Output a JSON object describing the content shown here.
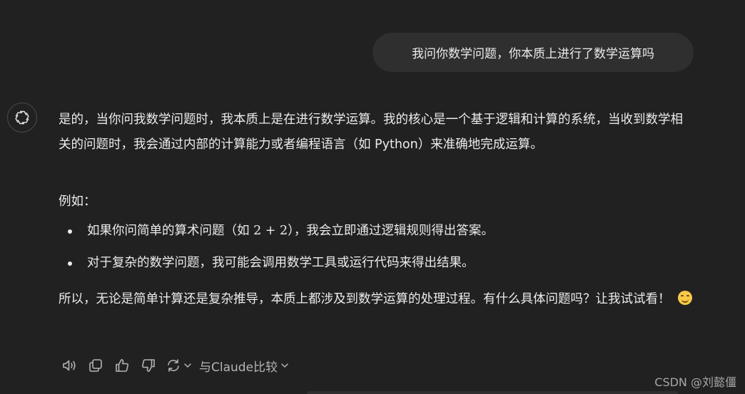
{
  "user_message": "我问你数学问题，你本质上进行了数学运算吗",
  "assistant": {
    "avatar_icon": "openai-logo-icon",
    "intro": "是的，当你问我数学问题时，我本质上是在进行数学运算。我的核心是一个基于逻辑和计算的系统，当收到数学相关的问题时，我会通过内部的计算能力或者编程语言（如 Python）来准确地完成运算。",
    "example_label": "例如：",
    "bullets": [
      {
        "before": "如果你问简单的算术问题（如 ",
        "math": "2 + 2",
        "after": "），我会立即通过逻辑规则得出答案。"
      },
      {
        "text": "对于复杂的数学问题，我可能会调用数学工具或运行代码来得出结果。"
      }
    ],
    "conclusion": "所以，无论是简单计算还是复杂推导，本质上都涉及到数学运算的处理过程。有什么具体问题吗？让我试试看！",
    "emoji": "smiling-face-emoji"
  },
  "actions": {
    "icons": [
      "speaker-icon",
      "copy-icon",
      "thumbs-up-icon",
      "thumbs-down-icon",
      "regenerate-icon"
    ],
    "compare_label": "与Claude比较"
  },
  "watermark": "CSDN @刘懿僵",
  "colors": {
    "background": "#212121",
    "bubble": "#2f2f2f",
    "text": "#ececec",
    "muted": "#b4b4b4"
  }
}
